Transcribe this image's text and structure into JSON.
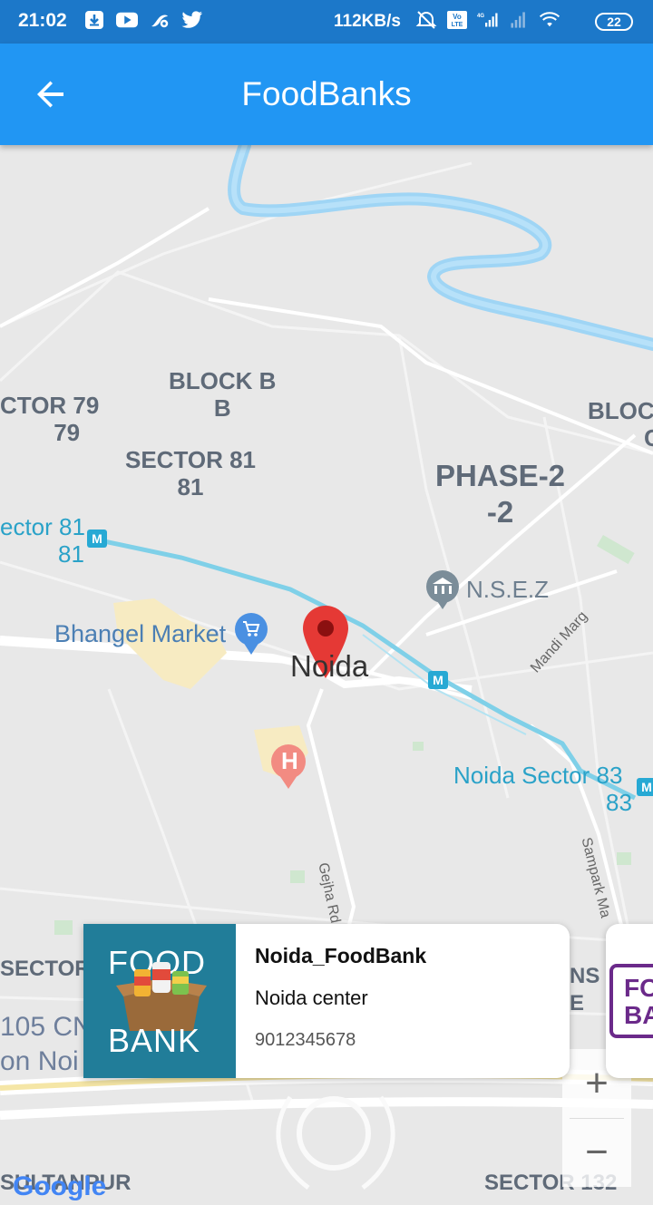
{
  "status_bar": {
    "time": "21:02",
    "net_speed": "112KB/s",
    "battery": "22"
  },
  "app_bar": {
    "title": "FoodBanks",
    "back_icon": "arrow-back-icon"
  },
  "map": {
    "labels": {
      "block_b": "BLOCK B",
      "block_b_sub": "B",
      "sector79": "CTOR 79",
      "sector79_sub": "79",
      "block_c": "BLOCK",
      "block_c_sub": "C",
      "sector81": "SECTOR 81",
      "sector81_sub": "81",
      "phase2": "PHASE-2",
      "phase2_sub": "-2",
      "sector81_metro": "ector 81",
      "sector81_metro_sub": "81",
      "nsez": "N.S.E.Z",
      "bhangel": "Bhangel Market",
      "noida": "Noida",
      "mandi_marg": "Mandi Marg",
      "noida_sector83": "Noida Sector 83",
      "noida_sector83_sub": "83",
      "gejha_rd": "Gejha Rd",
      "sampark_marg": "Sampark Ma",
      "sector_left": "SECTOR",
      "sector105": "105 CN",
      "on_noida": "on Noi",
      "ns": "NS",
      "e": "E",
      "sultanpur": "SULTANPUR",
      "sector132": "SECTOR 132",
      "google": "Google",
      "metro_badge": "M",
      "hospital": "H"
    }
  },
  "foodbank_card": {
    "name": "Noida_FoodBank",
    "center": "Noida center",
    "phone": "9012345678",
    "logo_top": "FOOD",
    "logo_bottom": "BANK"
  },
  "foodbank_card_next": {
    "logo_text_top": "FO",
    "logo_text_bottom": "BA"
  },
  "zoom": {
    "plus": "+",
    "minus": "−"
  },
  "colors": {
    "status_bar": "#1c78c9",
    "app_bar": "#2196f3",
    "map_bg": "#e8e8e8",
    "river": "#9fd5f5",
    "metro_line": "#7fd0e8",
    "marker": "#e53935",
    "card_image_bg": "#217d99"
  }
}
